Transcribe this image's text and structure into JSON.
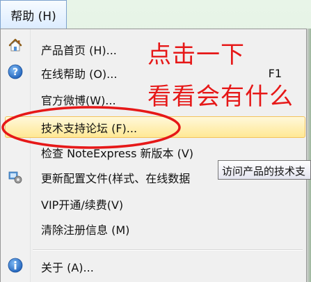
{
  "menubar": {
    "help_label": "帮助 (H)"
  },
  "menu": {
    "items": [
      {
        "label": "产品首页 (H)...",
        "shortcut": "",
        "icon": "home-icon"
      },
      {
        "label": "在线帮助 (O)...",
        "shortcut": "F1",
        "icon": "help-icon"
      },
      {
        "label": "官方微博(W)...",
        "shortcut": "",
        "icon": ""
      },
      {
        "label": "技术支持论坛 (F)...",
        "shortcut": "",
        "icon": ""
      },
      {
        "label": "检查 NoteExpress 新版本 (V)",
        "shortcut": "",
        "icon": ""
      },
      {
        "label": "更新配置文件(样式、在线数据",
        "shortcut": "",
        "icon": "update-config-icon"
      },
      {
        "label": "VIP开通/续费(V)",
        "shortcut": "",
        "icon": ""
      },
      {
        "label": "清除注册信息 (M)",
        "shortcut": "",
        "icon": ""
      },
      {
        "label": "关于 (A)...",
        "shortcut": "",
        "icon": "info-icon"
      }
    ]
  },
  "tooltip": {
    "text": "访问产品的技术支"
  },
  "annotation": {
    "line1": "点击一下",
    "line2": "看看会有什么",
    "color": "#e61818"
  }
}
